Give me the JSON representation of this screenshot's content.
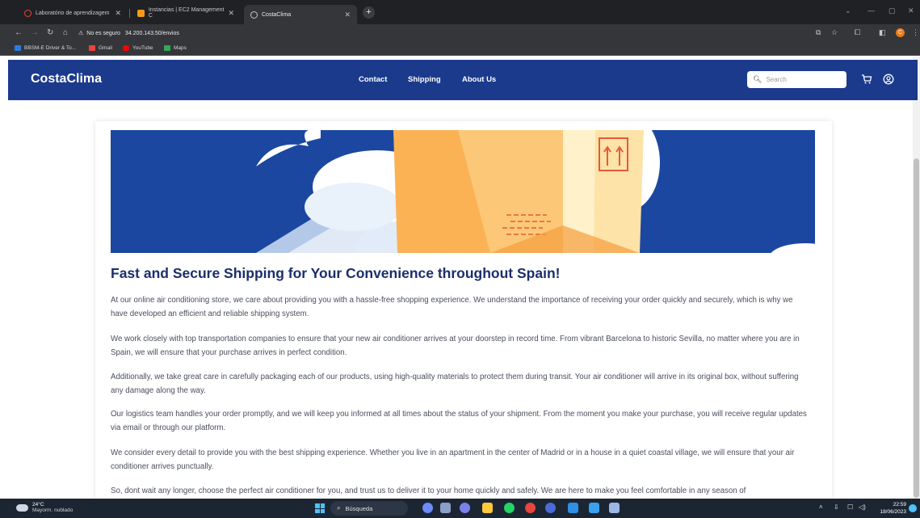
{
  "browser": {
    "tabs": [
      {
        "label": "Laboratório de aprendizagem",
        "active": false
      },
      {
        "label": "Instancias | EC2 Management C",
        "active": false
      },
      {
        "label": "CostaClima",
        "active": true
      }
    ],
    "new_tab": "+",
    "security_warning": "No es seguro",
    "url": "34.200.143.50/envios",
    "profile_initial": "C",
    "bookmarks": [
      "BBSM-E Driver & To...",
      "Gmail",
      "YouTube",
      "Maps"
    ]
  },
  "site": {
    "brand": "CostaClima",
    "nav": [
      "Contact",
      "Shipping",
      "About Us"
    ],
    "search_placeholder": "Search",
    "accent": "#1b3a8c"
  },
  "content": {
    "heading": "Fast and Secure Shipping for Your Convenience throughout Spain!",
    "paragraphs": [
      "At our online air conditioning store, we care about providing you with a hassle-free shopping experience. We understand the importance of receiving your order quickly and securely, which is why we have developed an efficient and reliable shipping system.",
      "We work closely with top transportation companies to ensure that your new air conditioner arrives at your doorstep in record time. From vibrant Barcelona to historic Sevilla, no matter where you are in Spain, we will ensure that your purchase arrives in perfect condition.",
      "Additionally, we take great care in carefully packaging each of our products, using high-quality materials to protect them during transit. Your air conditioner will arrive in its original box, without suffering any damage along the way.",
      "Our logistics team handles your order promptly, and we will keep you informed at all times about the status of your shipment. From the moment you make your purchase, you will receive regular updates via email or through our platform.",
      "We consider every detail to provide you with the best shipping experience. Whether you live in an apartment in the center of Madrid or in a house in a quiet coastal village, we will ensure that your air conditioner arrives punctually.",
      "So, dont wait any longer, choose the perfect air conditioner for you, and trust us to deliver it to your home quickly and safely. We are here to make you feel comfortable in any season of"
    ]
  },
  "taskbar": {
    "temperature": "24°C",
    "weather": "Mayorm. nublado",
    "search": "Búsqueda",
    "time": "22:59",
    "date": "18/06/2023"
  }
}
